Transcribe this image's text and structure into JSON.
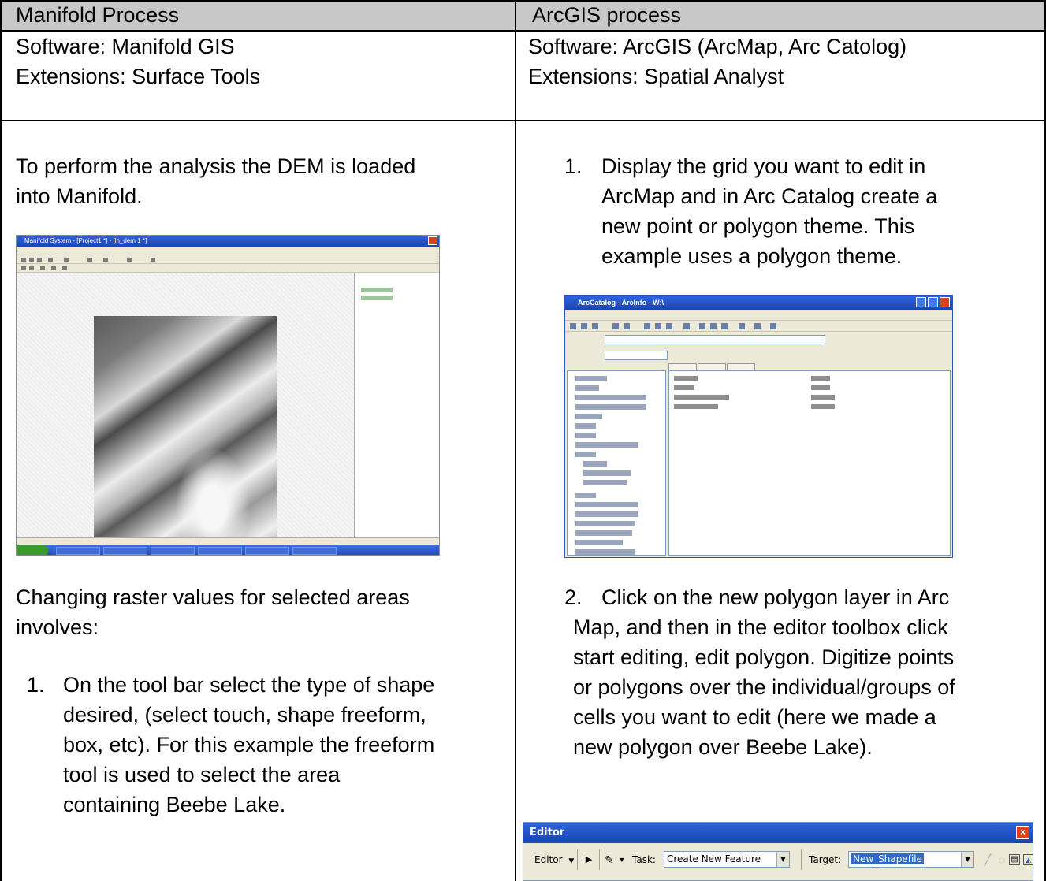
{
  "table": {
    "headers": [
      "Manifold Process",
      "ArcGIS process"
    ],
    "left": {
      "software": "Software: Manifold GIS",
      "extensions": "Extensions: Surface Tools",
      "intro_line1": "To perform the analysis the DEM is loaded",
      "intro_line2": "into Manifold.",
      "change_line1": "Changing raster values for selected areas",
      "change_line2": "involves:",
      "step1_num": "1.",
      "step1_lines": [
        "On the tool bar select the type of shape",
        "desired, (select touch, shape freeform,",
        "box, etc). For this example the freeform",
        "tool is used to select the area",
        "containing Beebe Lake."
      ]
    },
    "right": {
      "software": "Software: ArcGIS (ArcMap, Arc Catolog)",
      "extensions": "Extensions: Spatial Analyst",
      "step1_num": "1.",
      "step1_lines": [
        "Display the grid you want to edit in",
        "ArcMap and in Arc Catalog create a",
        "new point or polygon theme.  This",
        "example uses a polygon theme."
      ],
      "step2_num": "2.",
      "step2_lines": [
        "Click on the new polygon layer in Arc",
        "Map, and then in the editor toolbox click",
        "start editing, edit polygon. Digitize points",
        "or polygons over the individual/groups of",
        "cells you want to edit (here we made a",
        "new polygon over Beebe Lake)."
      ]
    }
  },
  "editor_toolbar": {
    "title": "Editor",
    "close_glyph": "×",
    "editor_menu": "Editor",
    "task_label": "Task:",
    "task_value": "Create New Feature",
    "target_label": "Target:",
    "target_value": "New_Shapefile",
    "dropdown_glyph": "▼",
    "arrow_glyph": "▶",
    "pencil_glyph": "✎"
  }
}
